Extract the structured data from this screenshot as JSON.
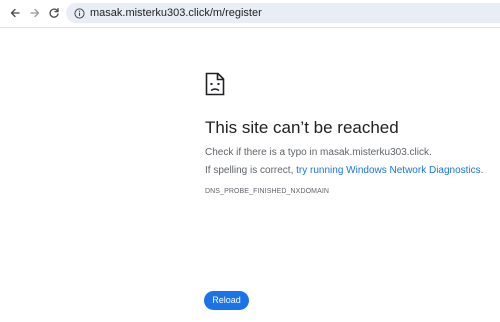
{
  "browser": {
    "url": "masak.misterku303.click/m/register",
    "icons": {
      "back": "arrow-left-icon",
      "forward": "arrow-right-icon",
      "reload": "reload-icon",
      "site_info": "info-icon"
    }
  },
  "error_page": {
    "icon": "sad-document-icon",
    "title": "This site can’t be reached",
    "typo_hint": "Check if there is a typo in masak.misterku303.click.",
    "spelling_prefix": "If spelling is correct, ",
    "diagnostics_link": "try running Windows Network Diagnostics",
    "spelling_suffix": ".",
    "error_code": "DNS_PROBE_FINISHED_NXDOMAIN",
    "reload_label": "Reload"
  },
  "colors": {
    "accent": "#1a73e8",
    "title": "#202124",
    "body_text": "#5f6368",
    "omnibox_bg": "#e9eef6"
  }
}
